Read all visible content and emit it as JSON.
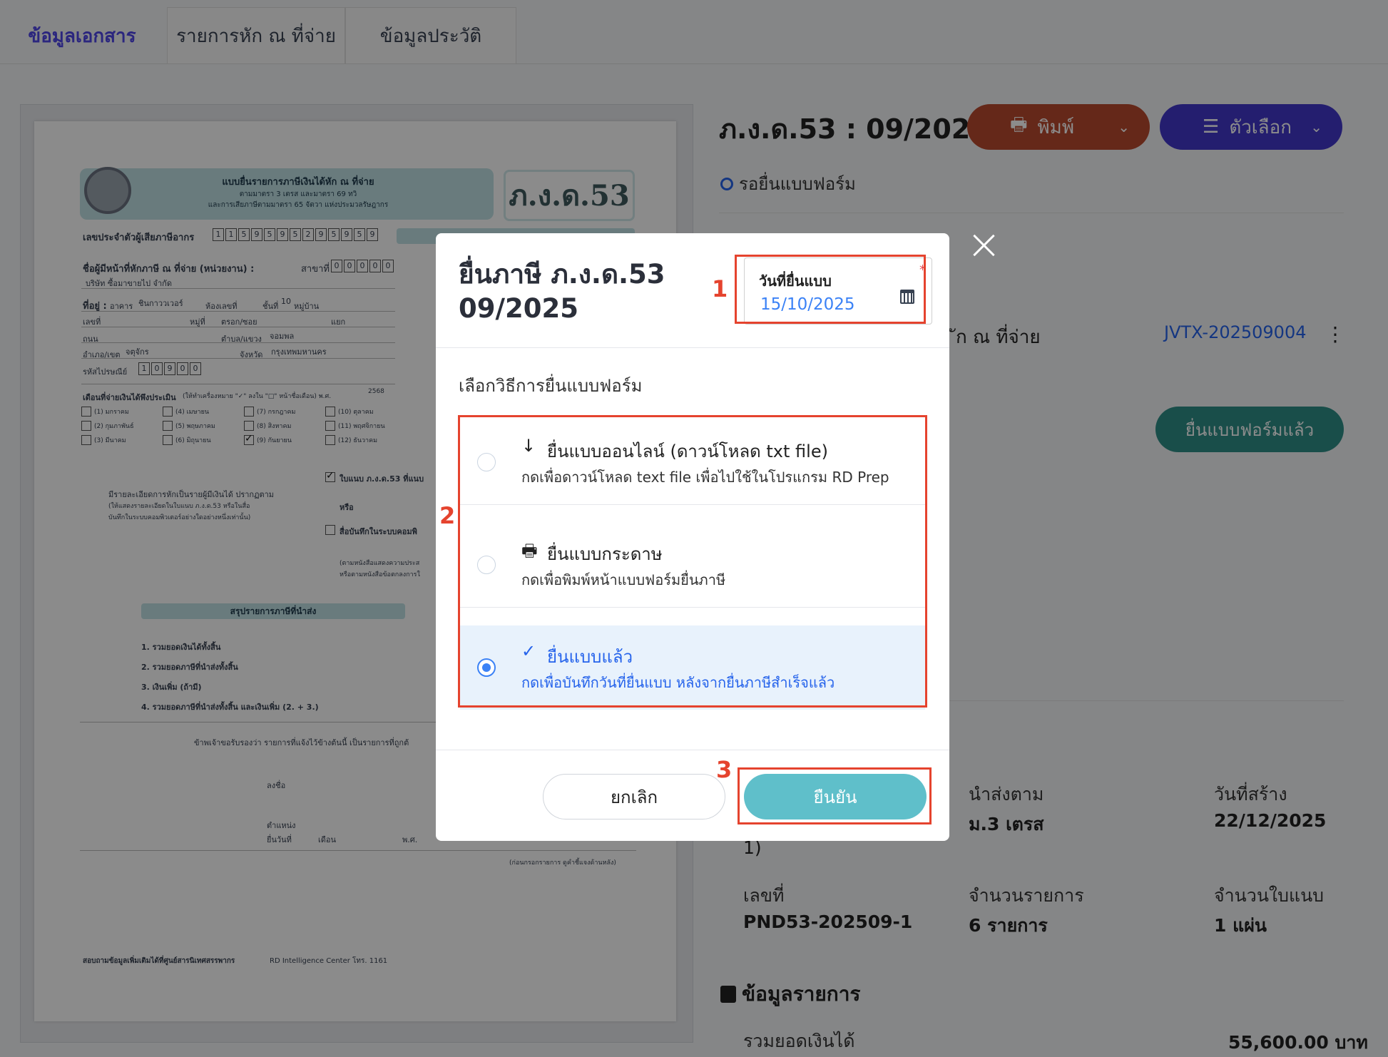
{
  "tabs": [
    {
      "label": "ข้อมูลเอกสาร",
      "active": true
    },
    {
      "label": "รายการหัก ณ ที่จ่าย",
      "active": false
    },
    {
      "label": "ข้อมูลประวัติ",
      "active": false
    }
  ],
  "document_preview": {
    "form_title": "แบบยื่นรายการภาษีเงินได้หัก ณ ที่จ่าย",
    "form_subtitle": "ตามมาตรา 3 เตรส และมาตรา 69 ทวิ",
    "form_subtitle2": "และการเสียภาษีตามมาตรา 65 จัตวา แห่งประมวลรัษฎากร",
    "form_code": "ภ.ง.ด.53",
    "tax_id_label": "เลขประจำตัวผู้เสียภาษีอากร",
    "tax_id_digits": [
      "1",
      "1",
      "5",
      "9",
      "5",
      "9",
      "5",
      "2",
      "9",
      "5",
      "9",
      "5",
      "9"
    ],
    "payer_label": "ชื่อผู้มีหน้าที่หักภาษี ณ ที่จ่าย (หน่วยงาน) :",
    "branch_label": "สาขาที่",
    "branch_digits": [
      "0",
      "0",
      "0",
      "0",
      "0"
    ],
    "company": "บริษัท ซื้อมาขายไป จำกัด",
    "address_label": "ที่อยู่ :",
    "building_prefix": "อาคาร",
    "building": "ชินกาววเวอร์",
    "room_label": "ห้องเลขที่",
    "floor_label": "ชั้นที่",
    "floor": "10",
    "village_label": "หมู่บ้าน",
    "no_label": "เลขที่",
    "moo_label": "หมู่ที่",
    "soi_label": "ตรอก/ซอย",
    "yaek_label": "แยก",
    "road_label": "ถนน",
    "subdistrict_label": "ตำบล/แขวง",
    "subdistrict": "จอมพล",
    "district_label": "อำเภอ/เขต",
    "district": "จตุจักร",
    "province_label": "จังหวัด",
    "province": "กรุงเทพมหานคร",
    "postcode_label": "รหัสไปรษณีย์",
    "postcode_digits": [
      "1",
      "0",
      "9",
      "0",
      "0"
    ],
    "month_label": "เดือนที่จ่ายเงินได้พึงประเมิน",
    "month_hint": "(ให้ทำเครื่องหมาย \"✓\" ลงใน \"□\" หน้าชื่อเดือน) พ.ศ.",
    "year": "2568",
    "months": [
      "(1) มกราคม",
      "(2) กุมภาพันธ์",
      "(3) มีนาคม",
      "(4) เมษายน",
      "(5) พฤษภาคม",
      "(6) มิถุนายน",
      "(7) กรกฎาคม",
      "(8) สิงหาคม",
      "(9) กันยายน",
      "(10) ตุลาคม",
      "(11) พฤศจิกายน",
      "(12) ธันวาคม"
    ],
    "checked_month_index": 8,
    "attachment_label": "ใบแนบ ภ.ง.ด.53 ที่แนบ",
    "detail_text": "มีรายละเอียดการหักเป็นรายผู้มีเงินได้ ปรากฏตาม",
    "detail_hint1": "(ให้แสดงรายละเอียดในใบแนบ ภ.ง.ด.53 หรือในสื่อ",
    "detail_hint2": "บันทึกในระบบคอมพิวเตอร์อย่างใดอย่างหนึ่งเท่านั้น)",
    "or_label": "หรือ",
    "media_label": "สื่อบันทึกในระบบคอมพิ",
    "media_hint1": "(ตามหนังสือแสดงความประส",
    "media_hint2": "หรือตามหนังสือข้อตกลงการใ",
    "summary_title": "สรุปรายการภาษีที่นำส่ง",
    "summary_items": [
      "1. รวมยอดเงินได้ทั้งสิ้น",
      "2. รวมยอดภาษีที่นำส่งทั้งสิ้น",
      "3. เงินเพิ่ม (ถ้ามี)",
      "4. รวมยอดภาษีที่นำส่งทั้งสิ้น และเงินเพิ่ม (2. + 3.)"
    ],
    "certify_text": "ข้าพเจ้าขอรับรองว่า รายการที่แจ้งไว้ข้างต้นนี้ เป็นรายการที่ถูกต้",
    "sign_label": "ลงชื่อ",
    "position_label": "ตำแหน่ง",
    "filed_label": "ยื่นวันที่",
    "month_word": "เดือน",
    "year_word": "พ.ศ.",
    "back_note": "(ก่อนกรอกรายการ ดูคำชี้แจงด้านหลัง)",
    "footer_note": "สอบถามข้อมูลเพิ่มเติมได้ที่ศูนย์สารนิเทศสรรพากร",
    "footer_center": "RD Intelligence Center โทร. 1161"
  },
  "header": {
    "title": "ภ.ง.ด.53 : 09/2025",
    "print_label": "พิมพ์",
    "options_label": "ตัวเลือก",
    "print_color": "#b84a2e",
    "options_color": "#4338ca"
  },
  "status": {
    "label": "รอยื่นแบบฟอร์ม",
    "color": "#2563eb"
  },
  "related": {
    "label_partial": "ัก ณ ที่จ่าย",
    "link": "JVTX-202509004"
  },
  "submitted_button_label": "ยื่นแบบฟอร์มแล้ว",
  "info": {
    "partial_value": "1)",
    "remit_label": "นำส่งตาม",
    "remit_value": "ม.3 เตรส",
    "created_label": "วันที่สร้าง",
    "created_value": "22/12/2025",
    "number_label": "เลขที่",
    "number_value": "PND53-202509-1",
    "items_label": "จำนวนรายการ",
    "items_value": "6 รายการ",
    "attach_label": "จำนวนใบแนบ",
    "attach_value": "1 แผ่น"
  },
  "section": {
    "title": "ข้อมูลรายการ",
    "total_label": "รวมยอดเงินได้",
    "total_value": "55,600.00 บาท"
  },
  "modal": {
    "title": "ยื่นภาษี ภ.ง.ด.53 09/2025",
    "date_label": "วันที่ยื่นแบบ",
    "date_required_mark": "*",
    "date_value": "15/10/2025",
    "choose_label": "เลือกวิธีการยื่นแบบฟอร์ม",
    "options": [
      {
        "icon": "download-icon",
        "title": "ยื่นแบบออนไลน์ (ดาวน์โหลด txt file)",
        "desc": "กดเพื่อดาวน์โหลด text file เพื่อไปใช้ในโปรแกรม RD Prep",
        "selected": false
      },
      {
        "icon": "printer-icon",
        "title": "ยื่นแบบกระดาษ",
        "desc": "กดเพื่อพิมพ์หน้าแบบฟอร์มยื่นภาษี",
        "selected": false
      },
      {
        "icon": "check-icon",
        "title": "ยื่นแบบแล้ว",
        "desc": "กดเพื่อบันทึกวันที่ยื่นแบบ หลังจากยื่นภาษีสำเร็จแล้ว",
        "selected": true
      }
    ],
    "cancel_label": "ยกเลิก",
    "confirm_label": "ยืนยัน"
  },
  "annotations": {
    "step1": "1",
    "step2": "2",
    "step3": "3",
    "color": "#e5432e"
  }
}
